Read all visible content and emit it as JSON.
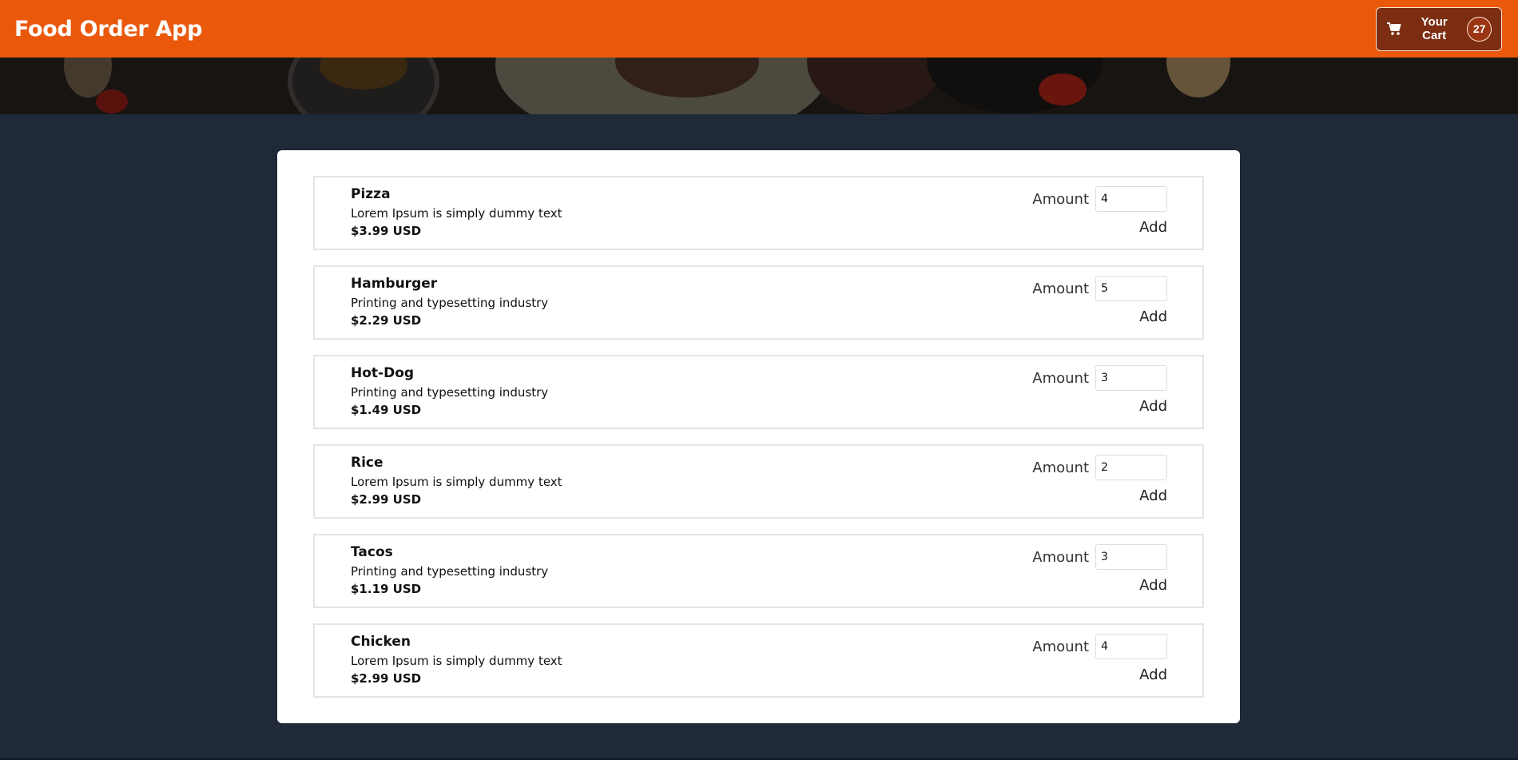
{
  "header": {
    "title": "Food Order App",
    "cart_label": "Your Cart",
    "cart_count": "27",
    "cart_icon": "shopping-cart-icon"
  },
  "colors": {
    "header_bg": "#ea580c",
    "cart_button_bg": "#7c2d12",
    "page_bg": "#1f2937",
    "card_bg": "#ffffff"
  },
  "meals": [
    {
      "name": "Pizza",
      "description": "Lorem Ipsum is simply dummy text",
      "price": "$3.99 USD",
      "amount_label": "Amount",
      "amount": "4",
      "add_label": "Add"
    },
    {
      "name": "Hamburger",
      "description": "Printing and typesetting industry",
      "price": "$2.29 USD",
      "amount_label": "Amount",
      "amount": "5",
      "add_label": "Add"
    },
    {
      "name": "Hot-Dog",
      "description": "Printing and typesetting industry",
      "price": "$1.49 USD",
      "amount_label": "Amount",
      "amount": "3",
      "add_label": "Add"
    },
    {
      "name": "Rice",
      "description": "Lorem Ipsum is simply dummy text",
      "price": "$2.99 USD",
      "amount_label": "Amount",
      "amount": "2",
      "add_label": "Add"
    },
    {
      "name": "Tacos",
      "description": "Printing and typesetting industry",
      "price": "$1.19 USD",
      "amount_label": "Amount",
      "amount": "3",
      "add_label": "Add"
    },
    {
      "name": "Chicken",
      "description": "Lorem Ipsum is simply dummy text",
      "price": "$2.99 USD",
      "amount_label": "Amount",
      "amount": "4",
      "add_label": "Add"
    }
  ]
}
